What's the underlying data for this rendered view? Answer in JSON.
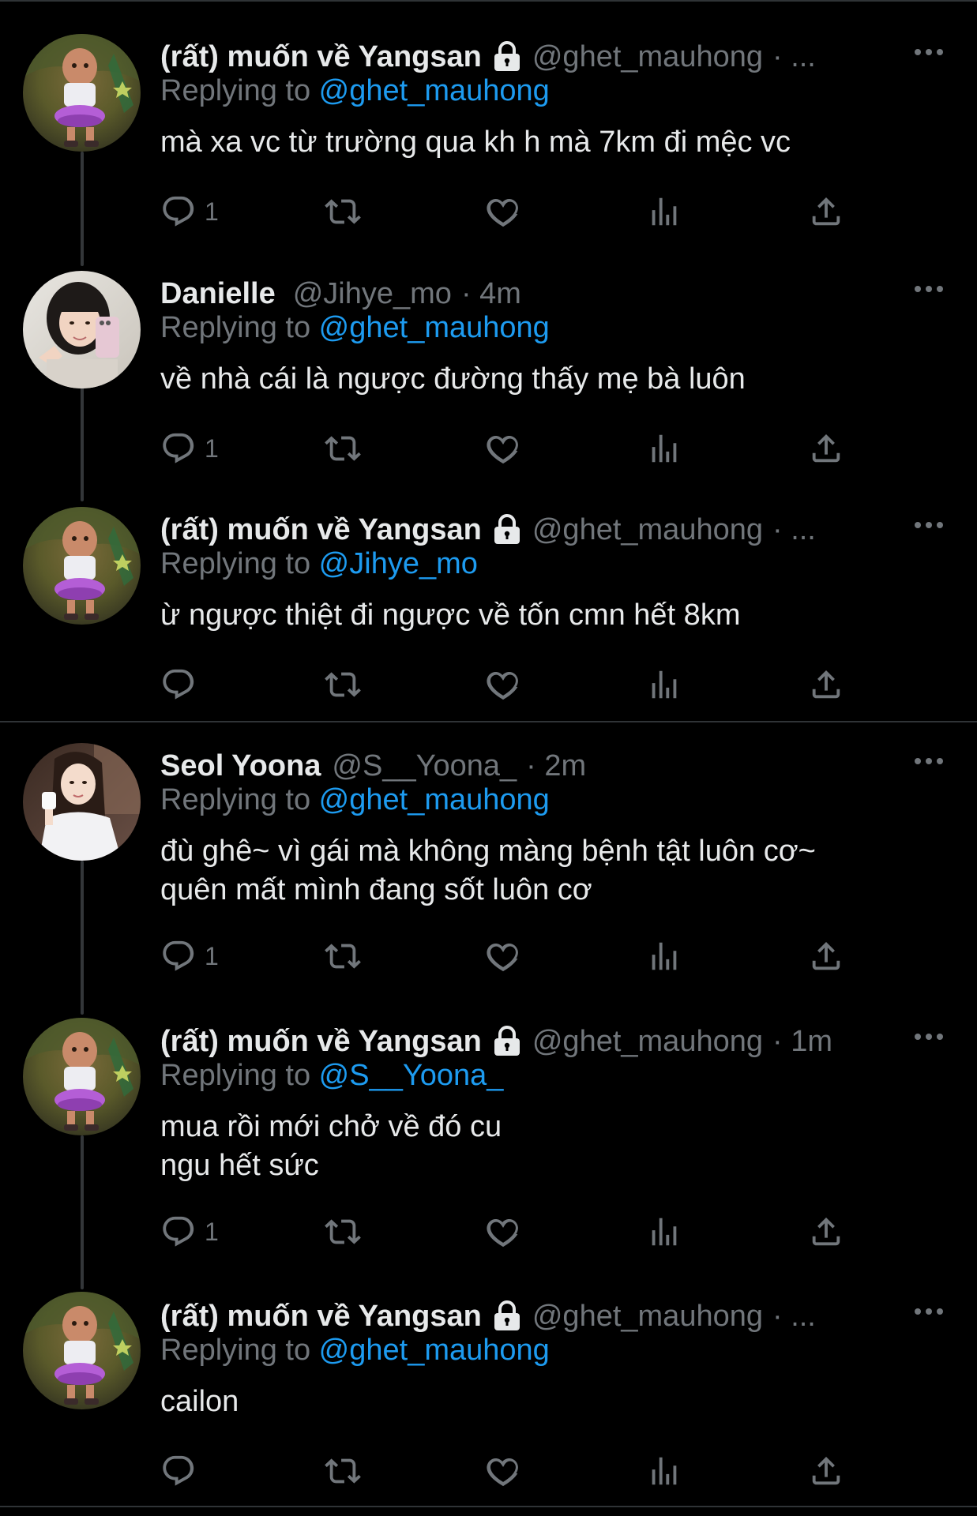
{
  "tweets": [
    {
      "name": "(rất) muốn về Yangsan",
      "handle": "@ghet_mauhong",
      "time": "· ...",
      "locked": true,
      "replying_label": "Replying to ",
      "replying_to": "@ghet_mauhong",
      "text": "mà xa vc từ trường qua kh h mà 7km đi mệc vc",
      "reply_count": "1"
    },
    {
      "name": "Danielle",
      "handle": "@Jihye_mo",
      "time": "· 4m",
      "locked": false,
      "replying_label": "Replying to ",
      "replying_to": "@ghet_mauhong",
      "text": "về nhà cái là ngược đường thấy mẹ bà luôn",
      "reply_count": "1"
    },
    {
      "name": "(rất) muốn về Yangsan",
      "handle": "@ghet_mauhong",
      "time": "· ...",
      "locked": true,
      "replying_label": "Replying to ",
      "replying_to": "@Jihye_mo",
      "text": "ừ ngược thiệt đi ngược về tốn cmn hết 8km",
      "reply_count": ""
    },
    {
      "name": "Seol Yoona",
      "handle": "@S__Yoona_",
      "time": "· 2m",
      "locked": false,
      "replying_label": "Replying to ",
      "replying_to": "@ghet_mauhong",
      "text": "đù ghê~ vì gái mà không màng bệnh tật luôn cơ~\nquên mất mình đang sốt luôn cơ",
      "reply_count": "1"
    },
    {
      "name": "(rất) muốn về Yangsan",
      "handle": "@ghet_mauhong",
      "time": "· 1m",
      "locked": true,
      "replying_label": "Replying to ",
      "replying_to": "@S__Yoona_",
      "text": "mua rồi mới chở về đó cu\nngu hết sức",
      "reply_count": "1"
    },
    {
      "name": "(rất) muốn về Yangsan",
      "handle": "@ghet_mauhong",
      "time": "· ...",
      "locked": true,
      "replying_label": "Replying to ",
      "replying_to": "@ghet_mauhong",
      "text": "cailon",
      "reply_count": ""
    }
  ],
  "icons": {
    "reply": "reply-icon",
    "retweet": "retweet-icon",
    "like": "heart-icon",
    "views": "views-icon",
    "share": "share-icon",
    "more": "more-icon",
    "lock": "lock-icon"
  },
  "colors": {
    "background": "#000000",
    "text": "#e7e9ea",
    "muted": "#71767b",
    "link": "#1d9bf0",
    "divider": "#2f3336"
  }
}
